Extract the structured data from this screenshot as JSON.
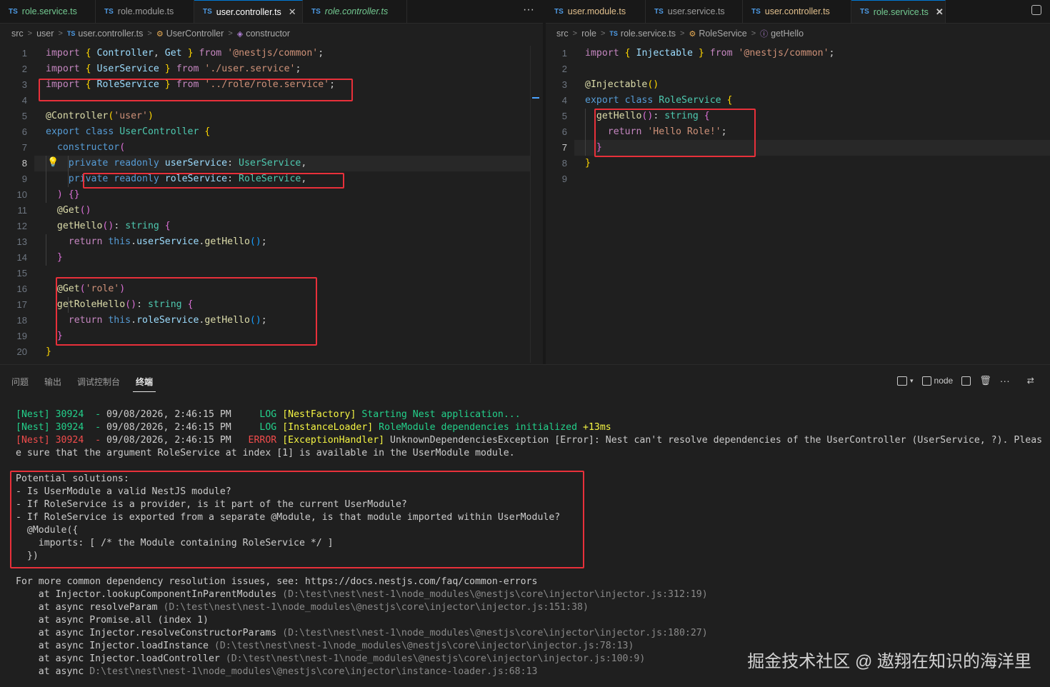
{
  "left_tabs": [
    {
      "label": "role.service.ts",
      "style": "green"
    },
    {
      "label": "role.module.ts",
      "style": "plain"
    },
    {
      "label": "user.controller.ts",
      "style": "active"
    },
    {
      "label": "role.controller.ts",
      "style": "italic-green"
    }
  ],
  "right_tabs": [
    {
      "label": "user.module.ts",
      "style": "yellow"
    },
    {
      "label": "user.service.ts",
      "style": "plain"
    },
    {
      "label": "user.controller.ts",
      "style": "yellow"
    },
    {
      "label": "role.service.ts",
      "style": "active-green"
    }
  ],
  "tab_icon": "TS",
  "more_label": "···",
  "left_breadcrumb": [
    "src",
    "user",
    "user.controller.ts",
    "UserController",
    "constructor"
  ],
  "right_breadcrumb": [
    "src",
    "role",
    "role.service.ts",
    "RoleService",
    "getHello"
  ],
  "left_line_numbers": [
    "1",
    "2",
    "3",
    "4",
    "5",
    "6",
    "7",
    "8",
    "9",
    "10",
    "11",
    "12",
    "13",
    "14",
    "15",
    "16",
    "17",
    "18",
    "19",
    "20"
  ],
  "right_line_numbers": [
    "1",
    "2",
    "3",
    "4",
    "5",
    "6",
    "7",
    "8",
    "9"
  ],
  "left_code": [
    "import { Controller, Get } from '@nestjs/common';",
    "import { UserService } from './user.service';",
    "import { RoleService } from '../role/role.service';",
    "",
    "@Controller('user')",
    "export class UserController {",
    "  constructor(",
    "    private readonly userService: UserService,",
    "    private readonly roleService: RoleService,",
    "  ) {}",
    "  @Get()",
    "  getHello(): string {",
    "    return this.userService.getHello();",
    "  }",
    "",
    "  @Get('role')",
    "  getRoleHello(): string {",
    "    return this.roleService.getHello();",
    "  }",
    "}"
  ],
  "right_code": [
    "import { Injectable } from '@nestjs/common';",
    "",
    "@Injectable()",
    "export class RoleService {",
    "  getHello(): string {",
    "    return 'Hello Role!';",
    "  }",
    "}",
    ""
  ],
  "panel_tabs": [
    "问题",
    "输出",
    "调试控制台",
    "终端"
  ],
  "panel_active": "终端",
  "terminal_profile": "node",
  "terminal_lines": {
    "l1_prefix": "[Nest] 30924  - ",
    "l1_date": "09/08/2026, 2:46:15 PM",
    "l1_level": "     LOG ",
    "l1_ctx": "[NestFactory] ",
    "l1_msg": "Starting Nest application...",
    "l2_prefix": "[Nest] 30924  - ",
    "l2_date": "09/08/2026, 2:46:15 PM",
    "l2_level": "     LOG ",
    "l2_ctx": "[InstanceLoader] ",
    "l2_msg": "RoleModule dependencies initialized ",
    "l2_time": "+13ms",
    "l3_prefix": "[Nest] 30924  - ",
    "l3_date": "09/08/2026, 2:46:15 PM",
    "l3_level": "   ERROR ",
    "l3_ctx": "[ExceptionHandler] ",
    "l3_msg": "UnknownDependenciesException [Error]: Nest can't resolve dependencies of the UserController (UserService, ?). Pleas",
    "l4": "e sure that the argument RoleService at index [1] is available in the UserModule module.",
    "sol": [
      "Potential solutions:",
      "- Is UserModule a valid NestJS module?",
      "- If RoleService is a provider, is it part of the current UserModule?",
      "- If RoleService is exported from a separate @Module, is that module imported within UserModule?",
      "  @Module({",
      "    imports: [ /* the Module containing RoleService */ ]",
      "  })"
    ],
    "more": "For more common dependency resolution issues, see: https://docs.nestjs.com/faq/common-errors"
  },
  "stack": [
    {
      "pre": "    at Injector.lookupComponentInParentModules ",
      "path": "(D:\\test\\nest\\nest-1\\node_modules\\@nestjs\\core\\injector\\injector.js:312:19)"
    },
    {
      "pre": "    at async resolveParam ",
      "path": "(D:\\test\\nest\\nest-1\\node_modules\\@nestjs\\core\\injector\\injector.js:151:38)"
    },
    {
      "pre": "    at async Promise.all (index 1)",
      "path": ""
    },
    {
      "pre": "    at async Injector.resolveConstructorParams ",
      "path": "(D:\\test\\nest\\nest-1\\node_modules\\@nestjs\\core\\injector\\injector.js:180:27)"
    },
    {
      "pre": "    at async Injector.loadInstance ",
      "path": "(D:\\test\\nest\\nest-1\\node_modules\\@nestjs\\core\\injector\\injector.js:78:13)"
    },
    {
      "pre": "    at async Injector.loadController ",
      "path": "(D:\\test\\nest\\nest-1\\node_modules\\@nestjs\\core\\injector\\injector.js:100:9)"
    },
    {
      "pre": "    at async ",
      "path": "D:\\test\\nest\\nest-1\\node_modules\\@nestjs\\core\\injector\\instance-loader.js:68:13"
    }
  ],
  "watermark": "掘金技术社区 @ 遨翔在知识的海洋里",
  "colors": {
    "highlight_box": "#e8303a",
    "accent": "#0078d4"
  }
}
